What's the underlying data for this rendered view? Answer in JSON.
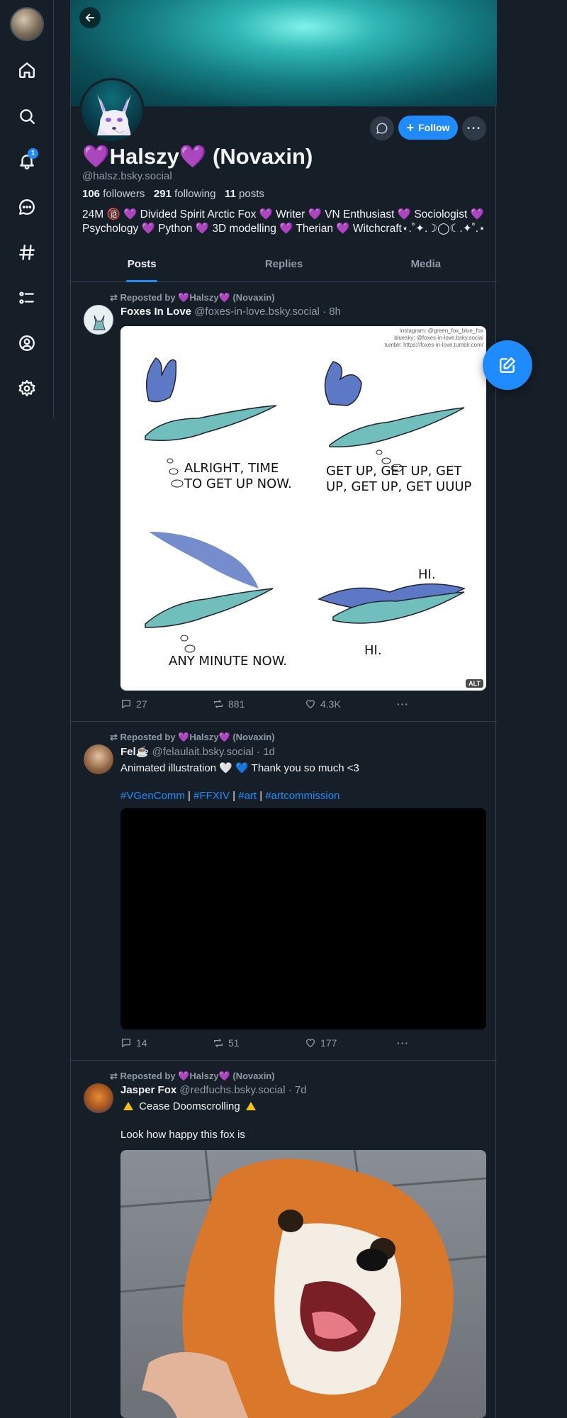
{
  "profile": {
    "display_name": "💜Halszy💜 (Novaxin)",
    "handle": "@halsz.bsky.social",
    "followers_count": "106",
    "followers_label": "followers",
    "following_count": "291",
    "following_label": "following",
    "posts_count": "11",
    "posts_label": "posts",
    "bio_line1": "24M 🔞 💜 Divided Spirit Arctic Fox 💜 Writer 💜 VN Enthusiast 💜 Sociologist 💜",
    "bio_line2": "Psychology 💜 Python 💜 3D modelling 💜 Therian 💜 Witchcraft⋆.˚✦.☽◯☾.✦˚.⋆",
    "follow_label": "Follow",
    "more_label": "···"
  },
  "sidebar": {
    "notification_count": "1",
    "icons": [
      "home-icon",
      "search-icon",
      "bell-icon",
      "chat-icon",
      "hashtag-icon",
      "list-icon",
      "profile-icon",
      "settings-icon"
    ]
  },
  "tabs": [
    {
      "label": "Posts"
    },
    {
      "label": "Replies"
    },
    {
      "label": "Media"
    }
  ],
  "posts": [
    {
      "repost_prefix": "Reposted by",
      "repost_by": "💜Halszy💜 (Novaxin)",
      "author": "Foxes In Love",
      "handle": "@foxes-in-love.bsky.social",
      "time": "· 8h",
      "comic_credit_1": "instagram: @green_fox_blue_fox",
      "comic_credit_2": "bluesky: @foxes-in-love.bsky.social",
      "comic_credit_3": "tumblr: https://foxes-in-love.tumblr.com/",
      "comic_panel_1": "ALRIGHT, TIME",
      "comic_panel_1b": "TO GET UP NOW.",
      "comic_panel_2": "GET UP, GET UP, GET",
      "comic_panel_2b": "UP, GET UP, GET UUUP",
      "comic_panel_3": "ANY MINUTE NOW.",
      "comic_panel_4a": "HI.",
      "comic_panel_4b": "HI.",
      "alt_label": "ALT",
      "replies": "27",
      "reposts": "881",
      "likes": "4.3K"
    },
    {
      "repost_prefix": "Reposted by",
      "repost_by": "💜Halszy💜 (Novaxin)",
      "author": "Fel☕",
      "handle": "@felaulait.bsky.social",
      "time": "· 1d",
      "text": "Animated illustration 🤍 💙 Thank you so much <3",
      "tags": [
        "#VGenComm",
        "#FFXIV",
        "#art",
        "#artcommission"
      ],
      "tag_sep": "|",
      "replies": "14",
      "reposts": "51",
      "likes": "177"
    },
    {
      "repost_prefix": "Reposted by",
      "repost_by": "💜Halszy💜 (Novaxin)",
      "author": "Jasper Fox",
      "handle": "@redfuchs.bsky.social",
      "time": "· 7d",
      "text": "Cease Doomscrolling",
      "text2": "Look how happy this fox is"
    }
  ]
}
